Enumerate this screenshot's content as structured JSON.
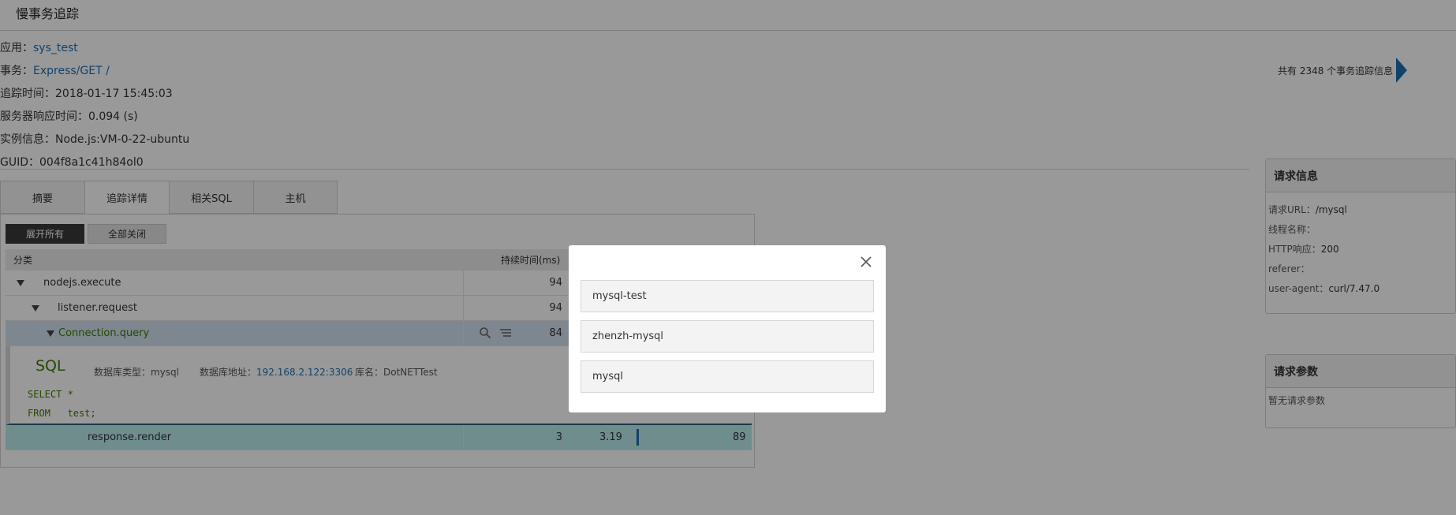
{
  "page": {
    "title": "慢事务追踪"
  },
  "info": {
    "app_label": "应用：",
    "app_value": "sys_test",
    "txn_label": "事务：",
    "txn_value": "Express/GET /",
    "trace_time_label": "追踪时间：",
    "trace_time_value": "2018-01-17 15:45:03",
    "resp_label": "服务器响应时间：",
    "resp_value": "0.094 (s)",
    "instance_label": "实例信息：",
    "instance_value": "Node.js:VM-0-22-ubuntu",
    "guid_label": "GUID：",
    "guid_value": "004f8a1c41h84ol0"
  },
  "pager": {
    "text": "共有 2348 个事务追踪信息"
  },
  "tabs": [
    {
      "label": "摘要"
    },
    {
      "label": "追踪详情"
    },
    {
      "label": "相关SQL"
    },
    {
      "label": "主机"
    }
  ],
  "toolbar": {
    "expand_all": "展开所有",
    "collapse_all": "全部关闭"
  },
  "trace": {
    "col_category": "分类",
    "col_duration": "持续时间(ms)",
    "rows": [
      {
        "name": "nodejs.execute",
        "duration": "94"
      },
      {
        "name": "listener.request",
        "duration": "94"
      },
      {
        "name": "Connection.query",
        "duration": "84"
      }
    ],
    "sql": {
      "title": "SQL",
      "db_type_label": "数据库类型：",
      "db_type_value": "mysql",
      "db_addr_label": "数据库地址：",
      "db_addr_value": "192.168.2.122:3306",
      "db_name_label": "库名：",
      "db_name_value": "DotNETTest",
      "line1": "SELECT *",
      "line2": "FROM   test;"
    },
    "render_row": {
      "name": "response.render",
      "duration": "3",
      "self": "3.19",
      "offset": "89"
    }
  },
  "request_info": {
    "title": "请求信息",
    "url_label": "请求URL：",
    "url_value": "/mysql",
    "thread_label": "线程名称：",
    "thread_value": "",
    "http_label": "HTTP响应：",
    "http_value": "200",
    "referer_label": "referer：",
    "referer_value": "",
    "ua_label": "user-agent：",
    "ua_value": "curl/7.47.0"
  },
  "request_params": {
    "title": "请求参数",
    "empty": "暂无请求参数"
  },
  "modal": {
    "options": [
      "mysql-test",
      "zhenzh-mysql",
      "mysql"
    ]
  },
  "colors": {
    "link": "#1b6fb3",
    "sql_green": "#3d7a00",
    "render_row": "#b7ece9",
    "overlay": "rgba(0,0,0,0.4)"
  }
}
